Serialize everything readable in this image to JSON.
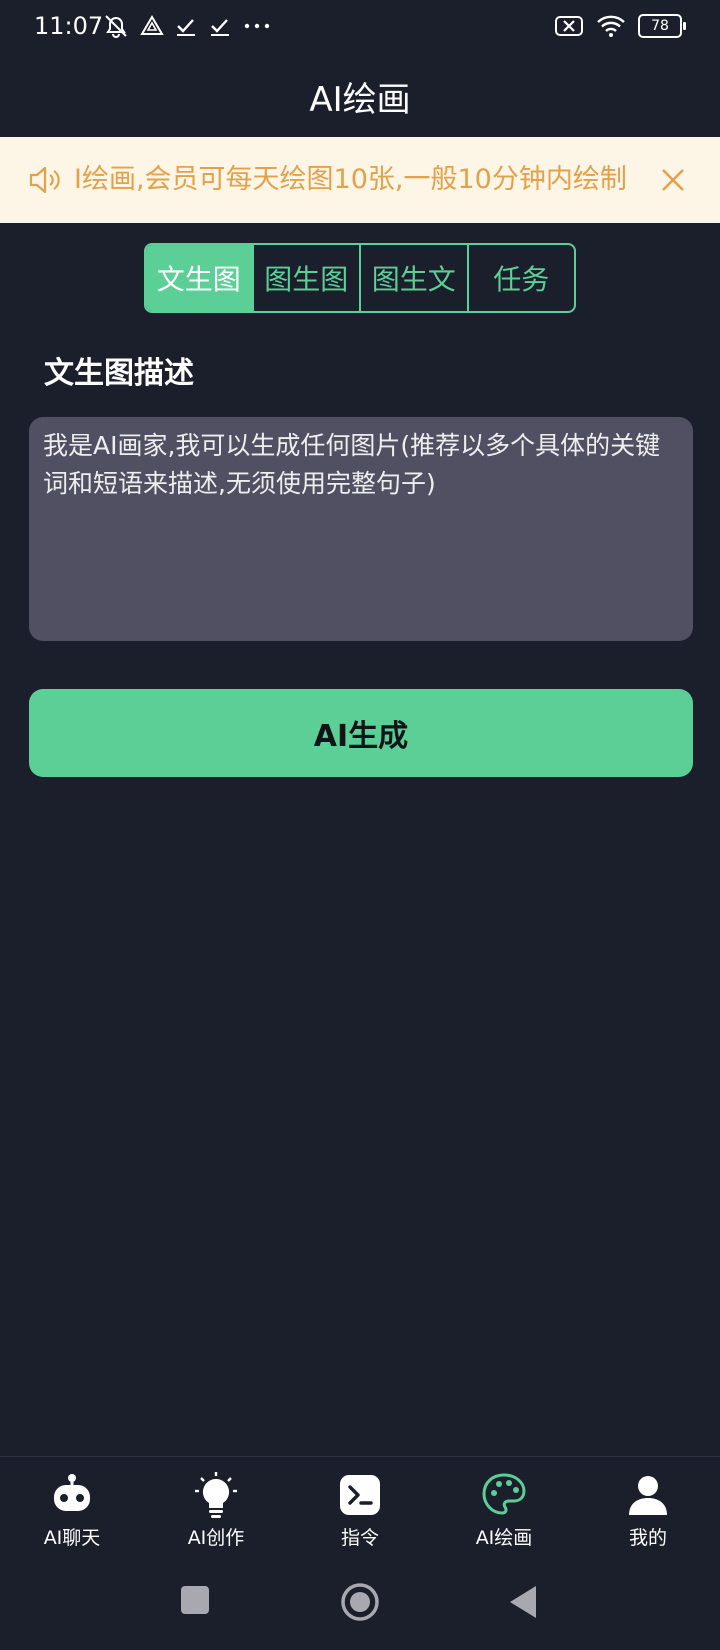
{
  "status_bar": {
    "time": "11:07",
    "battery": "78"
  },
  "header": {
    "title": "AI绘画"
  },
  "notice": {
    "text": "I绘画,会员可每天绘图10张,一般10分钟内绘制"
  },
  "tabs": [
    {
      "label": "文生图",
      "active": true
    },
    {
      "label": "图生图",
      "active": false
    },
    {
      "label": "图生文",
      "active": false
    },
    {
      "label": "任务",
      "active": false
    }
  ],
  "section": {
    "title": "文生图描述"
  },
  "prompt": {
    "placeholder": "我是AI画家,我可以生成任何图片(推荐以多个具体的关键词和短语来描述,无须使用完整句子)"
  },
  "generate_button": {
    "label": "AI生成"
  },
  "bottom_nav": {
    "items": [
      {
        "label": "AI聊天",
        "icon": "robot-icon"
      },
      {
        "label": "AI创作",
        "icon": "lightbulb-icon"
      },
      {
        "label": "指令",
        "icon": "terminal-icon"
      },
      {
        "label": "AI绘画",
        "icon": "palette-icon",
        "active": true
      },
      {
        "label": "我的",
        "icon": "user-icon"
      }
    ]
  },
  "colors": {
    "background": "#1b1f2b",
    "accent": "#5bcf96",
    "notice_bg": "#fdf6e6",
    "notice_text": "#e4a14b",
    "input_bg": "#514f62"
  }
}
